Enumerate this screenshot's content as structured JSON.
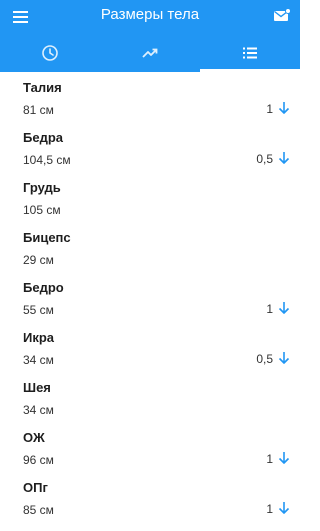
{
  "header": {
    "title": "Размеры тела",
    "menu_icon": "menu-icon",
    "mail_icon": "mail-icon"
  },
  "tabs": [
    {
      "icon": "clock-icon",
      "active": false
    },
    {
      "icon": "trending-up-icon",
      "active": false
    },
    {
      "icon": "list-icon",
      "active": true
    }
  ],
  "colors": {
    "primary": "#2196f3",
    "arrow": "#2196f3",
    "text": "#222222"
  },
  "measurements": [
    {
      "name": "Талия",
      "value": "81 см",
      "delta": "1",
      "trend": "down"
    },
    {
      "name": "Бедра",
      "value": "104,5 см",
      "delta": "0,5",
      "trend": "down"
    },
    {
      "name": "Грудь",
      "value": "105 см",
      "delta": "",
      "trend": ""
    },
    {
      "name": "Бицепс",
      "value": "29 см",
      "delta": "",
      "trend": ""
    },
    {
      "name": "Бедро",
      "value": "55 см",
      "delta": "1",
      "trend": "down"
    },
    {
      "name": "Икра",
      "value": "34 см",
      "delta": "0,5",
      "trend": "down"
    },
    {
      "name": "Шея",
      "value": "34 см",
      "delta": "",
      "trend": ""
    },
    {
      "name": "ОЖ",
      "value": "96 см",
      "delta": "1",
      "trend": "down"
    },
    {
      "name": "ОПг",
      "value": "85 см",
      "delta": "1",
      "trend": "down"
    }
  ]
}
